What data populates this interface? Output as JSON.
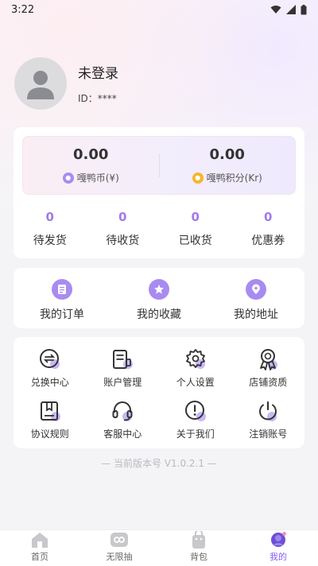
{
  "status_bar": {
    "time": "3:22"
  },
  "profile": {
    "name": "未登录",
    "id_label": "ID：****"
  },
  "wallet": [
    {
      "value": "0.00",
      "label": "嘎鸭币(¥)",
      "icon": "coin-purple-icon"
    },
    {
      "value": "0.00",
      "label": "嘎鸭积分(Kr)",
      "icon": "coin-gold-icon"
    }
  ],
  "orders": [
    {
      "count": "0",
      "label": "待发货"
    },
    {
      "count": "0",
      "label": "待收货"
    },
    {
      "count": "0",
      "label": "已收货"
    },
    {
      "count": "0",
      "label": "优惠券"
    }
  ],
  "shortcuts": [
    {
      "label": "我的订单",
      "icon": "order-list-icon"
    },
    {
      "label": "我的收藏",
      "icon": "star-icon"
    },
    {
      "label": "我的地址",
      "icon": "location-pin-icon"
    }
  ],
  "services": [
    {
      "label": "兑换中心",
      "icon": "exchange-icon"
    },
    {
      "label": "账户管理",
      "icon": "account-icon"
    },
    {
      "label": "个人设置",
      "icon": "gear-icon"
    },
    {
      "label": "店铺资质",
      "icon": "award-badge-icon"
    },
    {
      "label": "协议规则",
      "icon": "bookmark-doc-icon"
    },
    {
      "label": "客服中心",
      "icon": "headset-icon"
    },
    {
      "label": "关于我们",
      "icon": "info-icon"
    },
    {
      "label": "注销账号",
      "icon": "power-icon"
    }
  ],
  "version_text": "— 当前版本号 V1.0.2.1 —",
  "tabbar": [
    {
      "label": "首页",
      "icon": "home-icon",
      "active": false
    },
    {
      "label": "无限抽",
      "icon": "infinity-icon",
      "active": false
    },
    {
      "label": "背包",
      "icon": "backpack-icon",
      "active": false
    },
    {
      "label": "我的",
      "icon": "profile-icon",
      "active": true
    }
  ],
  "colors": {
    "accent": "#a88bf0",
    "accent_text": "#a07ae8",
    "gold": "#f5b62c"
  }
}
